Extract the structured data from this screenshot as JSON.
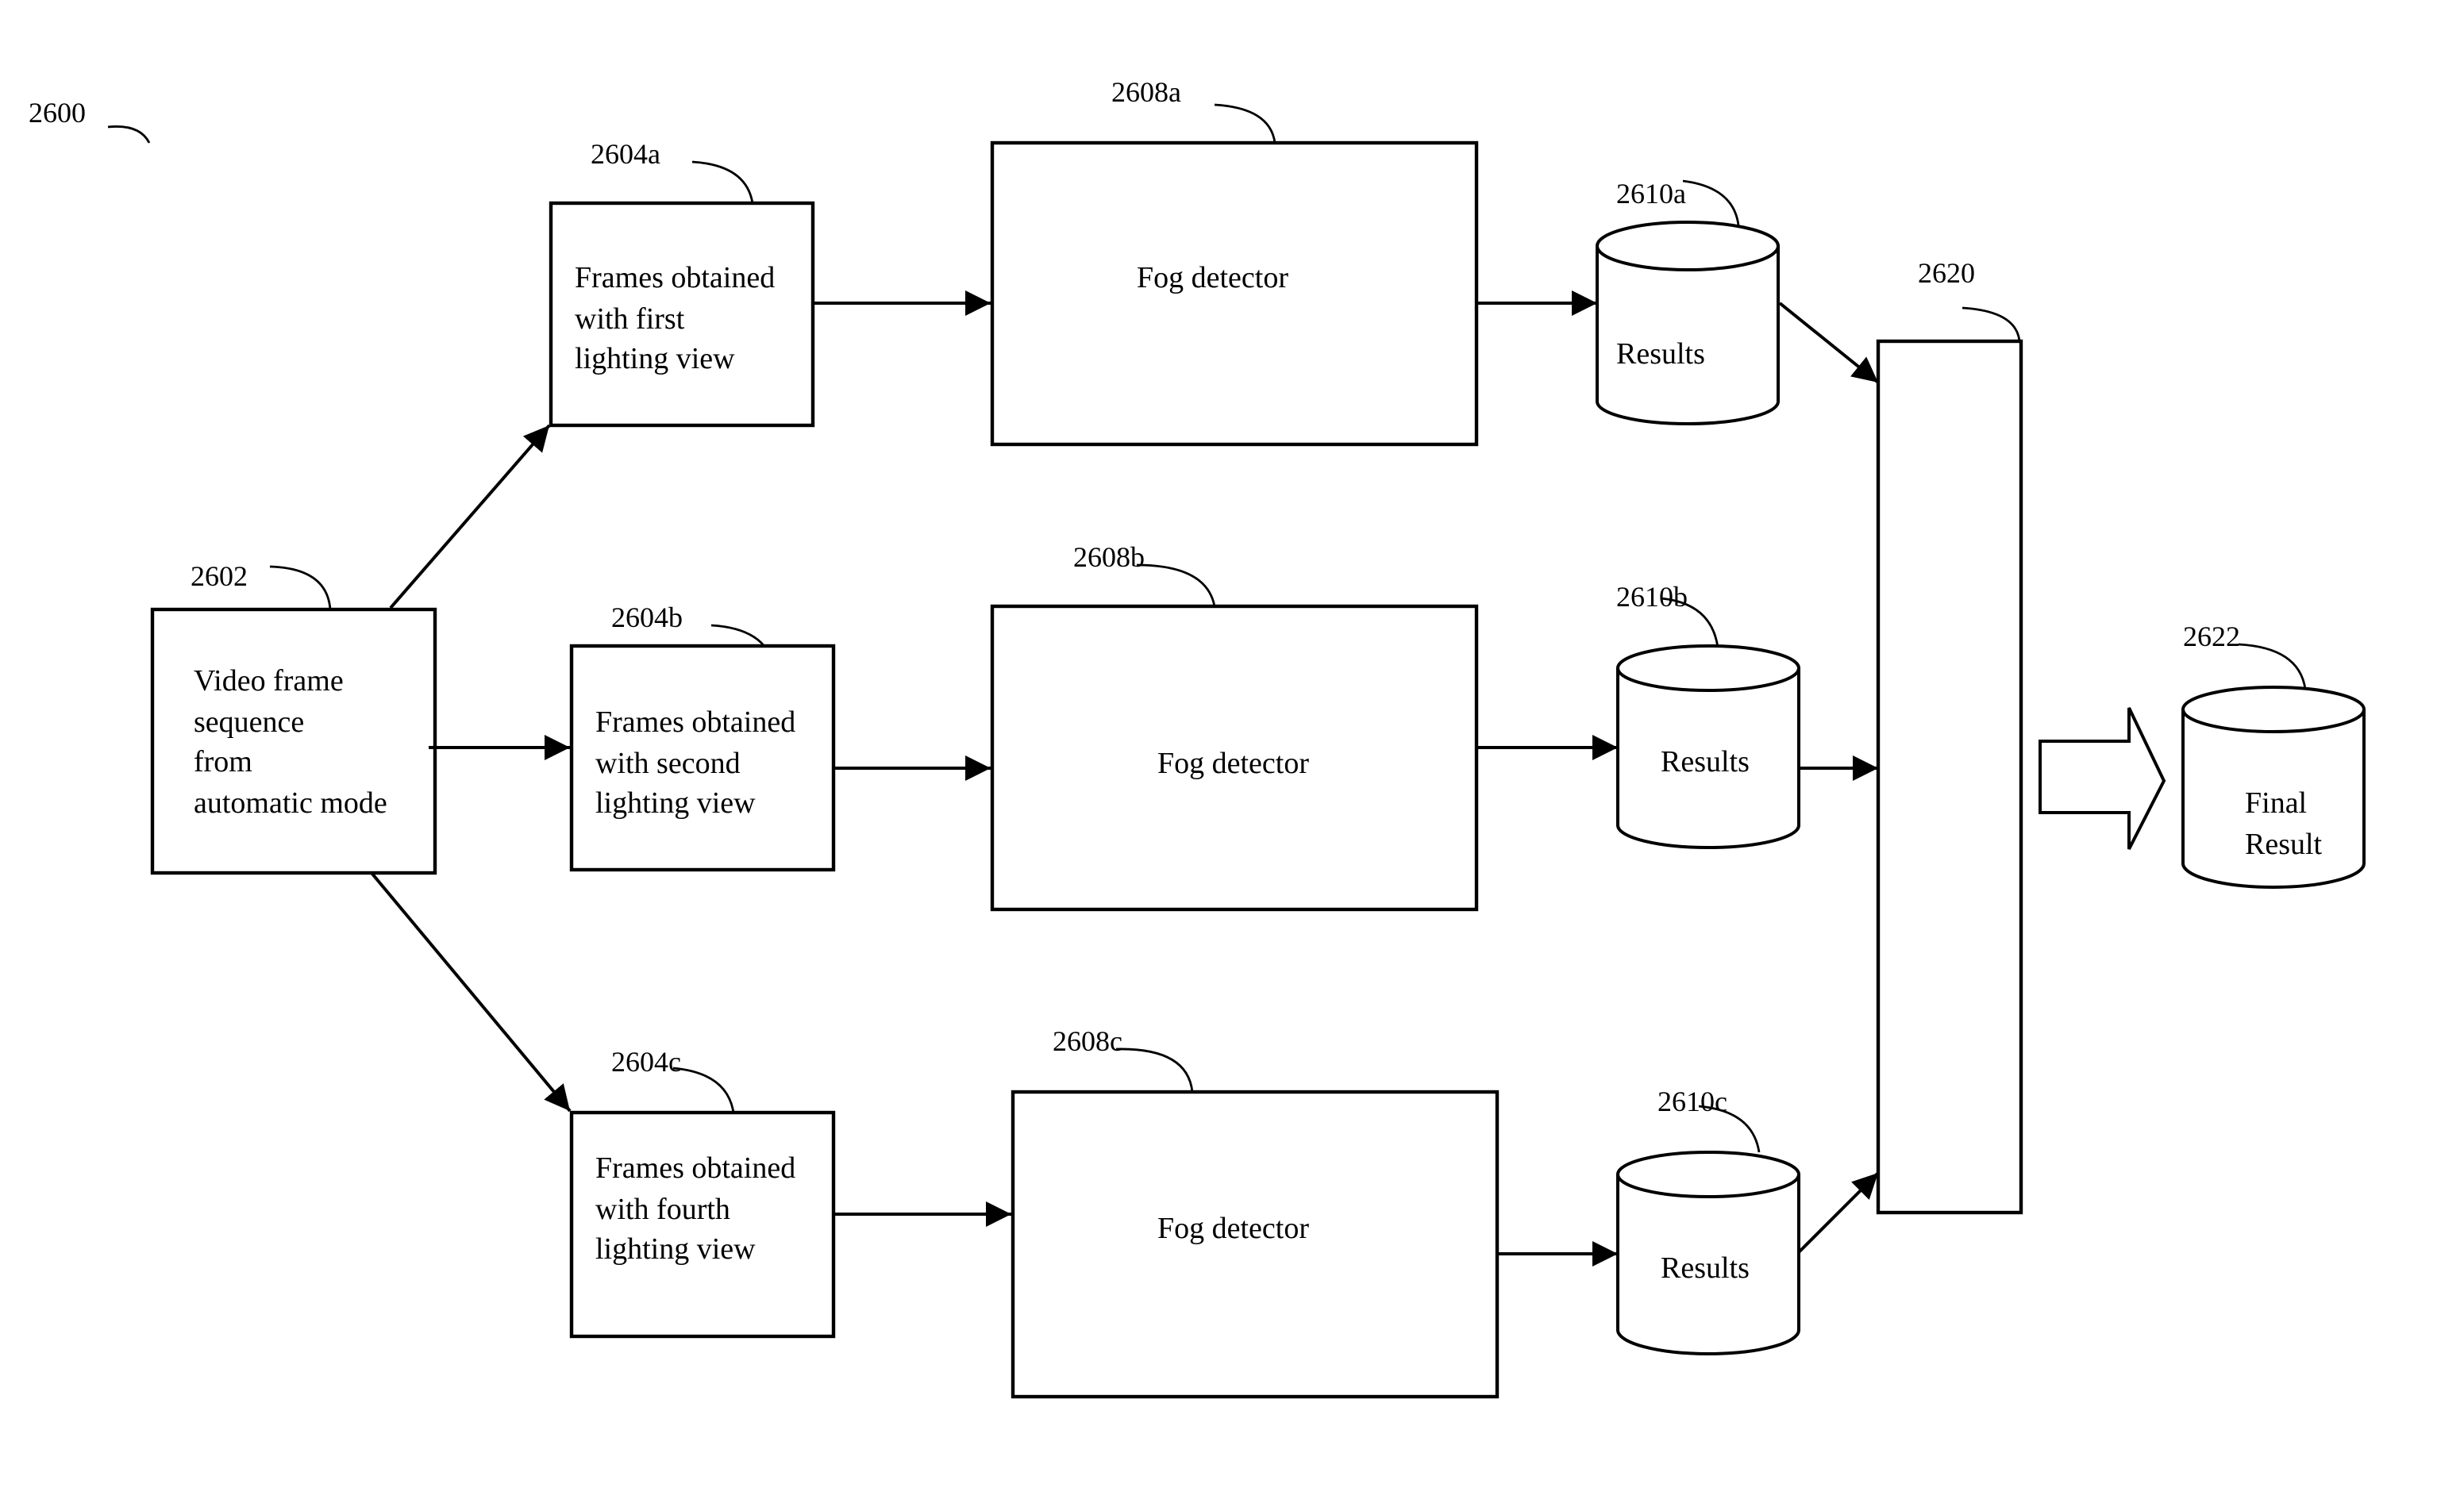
{
  "figure": {
    "reference": "2600",
    "colors": {
      "stroke": "#000000",
      "background": "#ffffff"
    }
  },
  "nodes": {
    "source": {
      "ref": "2602",
      "lines": [
        "Video frame",
        "sequence",
        "from",
        "automatic mode"
      ]
    },
    "frames_a": {
      "ref": "2604a",
      "lines": [
        "Frames obtained",
        "with first",
        "lighting view"
      ]
    },
    "frames_b": {
      "ref": "2604b",
      "lines": [
        "Frames obtained",
        "with second",
        "lighting view"
      ]
    },
    "frames_c": {
      "ref": "2604c",
      "lines": [
        "Frames obtained",
        "with fourth",
        "lighting view"
      ]
    },
    "fog_a": {
      "ref": "2608a",
      "label": "Fog detector"
    },
    "fog_b": {
      "ref": "2608b",
      "label": "Fog detector"
    },
    "fog_c": {
      "ref": "2608c",
      "label": "Fog detector"
    },
    "results_a": {
      "ref": "2610a",
      "label": "Results"
    },
    "results_b": {
      "ref": "2610b",
      "label": "Results"
    },
    "results_c": {
      "ref": "2610c",
      "label": "Results"
    },
    "combiner": {
      "ref": "2620"
    },
    "final": {
      "ref": "2622",
      "lines": [
        "Final",
        "Result"
      ]
    }
  },
  "edges": [
    {
      "from": "source",
      "to": "frames_a"
    },
    {
      "from": "source",
      "to": "frames_b"
    },
    {
      "from": "source",
      "to": "frames_c"
    },
    {
      "from": "frames_a",
      "to": "fog_a"
    },
    {
      "from": "frames_b",
      "to": "fog_b"
    },
    {
      "from": "frames_c",
      "to": "fog_c"
    },
    {
      "from": "fog_a",
      "to": "results_a"
    },
    {
      "from": "fog_b",
      "to": "results_b"
    },
    {
      "from": "fog_c",
      "to": "results_c"
    },
    {
      "from": "results_a",
      "to": "combiner"
    },
    {
      "from": "results_b",
      "to": "combiner"
    },
    {
      "from": "results_c",
      "to": "combiner"
    },
    {
      "from": "combiner",
      "to": "final",
      "style": "block-arrow"
    }
  ]
}
